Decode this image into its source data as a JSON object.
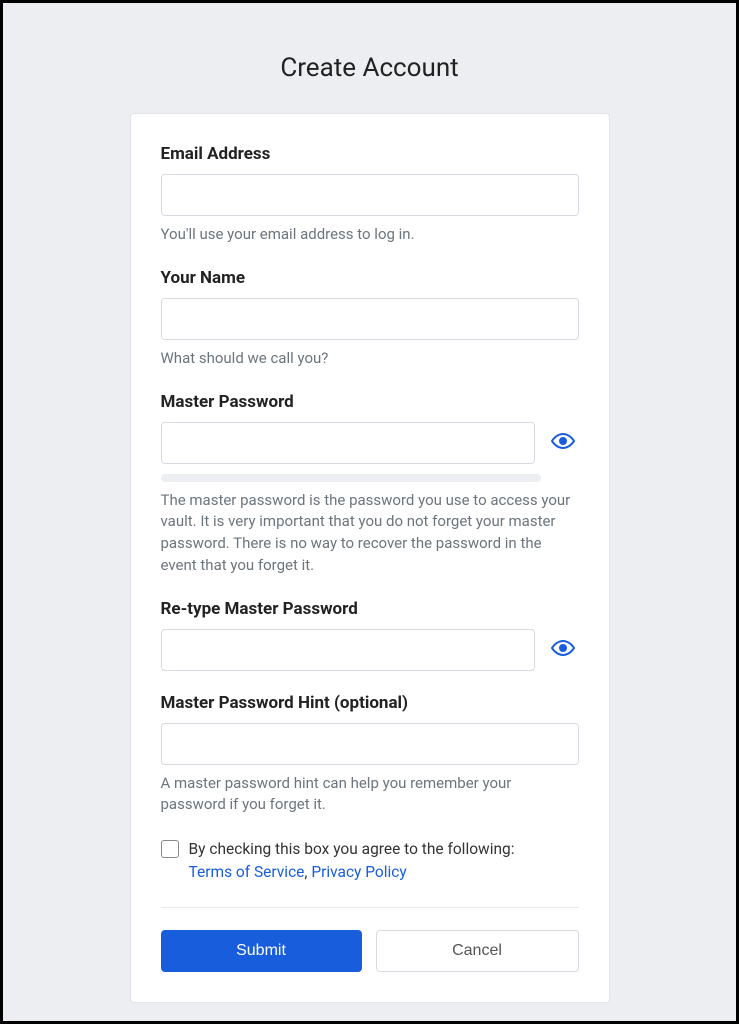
{
  "page": {
    "title": "Create Account"
  },
  "form": {
    "email": {
      "label": "Email Address",
      "value": "",
      "hint": "You'll use your email address to log in."
    },
    "name": {
      "label": "Your Name",
      "value": "",
      "hint": "What should we call you?"
    },
    "masterPassword": {
      "label": "Master Password",
      "value": "",
      "hint": "The master password is the password you use to access your vault. It is very important that you do not forget your master password. There is no way to recover the password in the event that you forget it."
    },
    "retypeMasterPassword": {
      "label": "Re-type Master Password",
      "value": ""
    },
    "passwordHint": {
      "label": "Master Password Hint (optional)",
      "value": "",
      "hint": "A master password hint can help you remember your password if you forget it."
    },
    "agreement": {
      "text": "By checking this box you agree to the following:",
      "termsLabel": "Terms of Service",
      "privacyLabel": "Privacy Policy",
      "separator": ", "
    },
    "buttons": {
      "submit": "Submit",
      "cancel": "Cancel"
    }
  }
}
